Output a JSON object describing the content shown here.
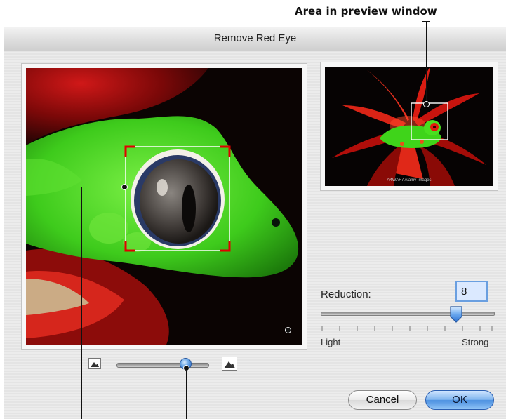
{
  "annotations": {
    "preview_callout": "Area in preview window"
  },
  "dialog": {
    "title": "Remove Red Eye"
  },
  "reduction": {
    "label": "Reduction:",
    "value": "8",
    "slider_level": 0.78,
    "min_label": "Light",
    "max_label": "Strong"
  },
  "zoom": {
    "slider_level": 0.74
  },
  "buttons": {
    "cancel": "Cancel",
    "ok": "OK"
  },
  "preview_caption": "A4WAF7 Alamy Images",
  "colors": {
    "selection_frame": "#ffffff",
    "selection_corners": "#ff0000",
    "default_button": "#4b90e0"
  }
}
